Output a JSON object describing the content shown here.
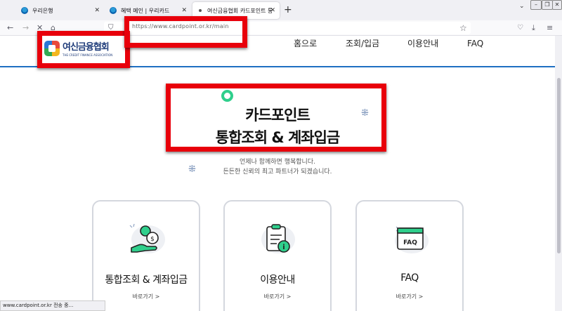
{
  "browser": {
    "tabs": [
      {
        "title": "우리은행"
      },
      {
        "title": "혜택 메인 | 우리카드"
      },
      {
        "title": "여신금융협회 카드포인트 통합"
      }
    ],
    "url": "https://www.cardpoint.or.kr/main",
    "status_text": "www.cardpoint.or.kr 전송 중..."
  },
  "site": {
    "logo": {
      "kr": "여신금융협회",
      "en": "THE CREDIT FINANCE ASSOCIATION"
    },
    "nav": [
      "홈으로",
      "조회/입금",
      "이용안내",
      "FAQ"
    ]
  },
  "hero": {
    "title_line1": "카드포인트",
    "title_line2": "통합조회 & 계좌입금",
    "sub_line1": "언제나 함께하면 행복합니다.",
    "sub_line2": "든든한 신뢰의 최고 파트너가 되겠습니다."
  },
  "cards": [
    {
      "title": "통합조회 & 계좌입금",
      "link": "바로가기 >",
      "icon": "hand-coin-icon"
    },
    {
      "title": "이용안내",
      "link": "바로가기 >",
      "icon": "clipboard-info-icon"
    },
    {
      "title": "FAQ",
      "link": "바로가기 >",
      "icon": "faq-window-icon"
    }
  ],
  "colors": {
    "accent_blue": "#1e6fc2",
    "green": "#2fcf8c",
    "highlight_red": "#e8000b"
  }
}
